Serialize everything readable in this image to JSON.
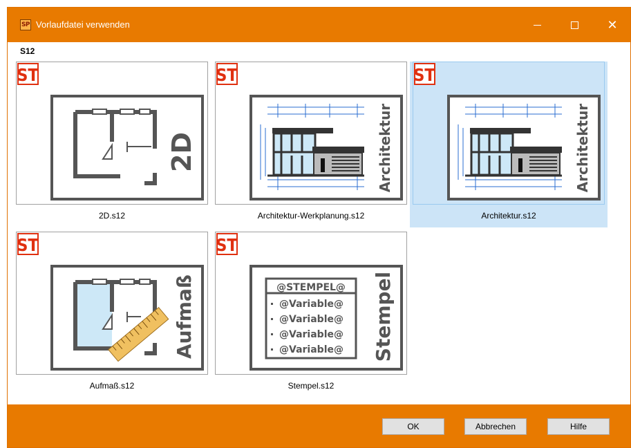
{
  "window": {
    "title": "Vorlaufdatei verwenden",
    "app_icon_text": "SP"
  },
  "group": {
    "label": "S12"
  },
  "templates": [
    {
      "label": "2D.s12",
      "badge": "ST",
      "caption": "2D",
      "selected": false
    },
    {
      "label": "Architektur-Werkplanung.s12",
      "badge": "ST",
      "caption": "Architektur",
      "selected": false
    },
    {
      "label": "Architektur.s12",
      "badge": "ST",
      "caption": "Architektur",
      "selected": true
    },
    {
      "label": "Aufmaß.s12",
      "badge": "ST",
      "caption": "Aufmaß",
      "selected": false
    },
    {
      "label": "Stempel.s12",
      "badge": "ST",
      "caption": "Stempel",
      "selected": false
    }
  ],
  "stempel": {
    "header": "@STEMPEL@",
    "rows": [
      "@Variable@",
      "@Variable@",
      "@Variable@",
      "@Variable@"
    ]
  },
  "buttons": {
    "ok": "OK",
    "cancel": "Abbrechen",
    "help": "Hilfe"
  },
  "colors": {
    "accent": "#e87a00",
    "selection": "#cce4f7",
    "badge_red": "#e03010"
  }
}
